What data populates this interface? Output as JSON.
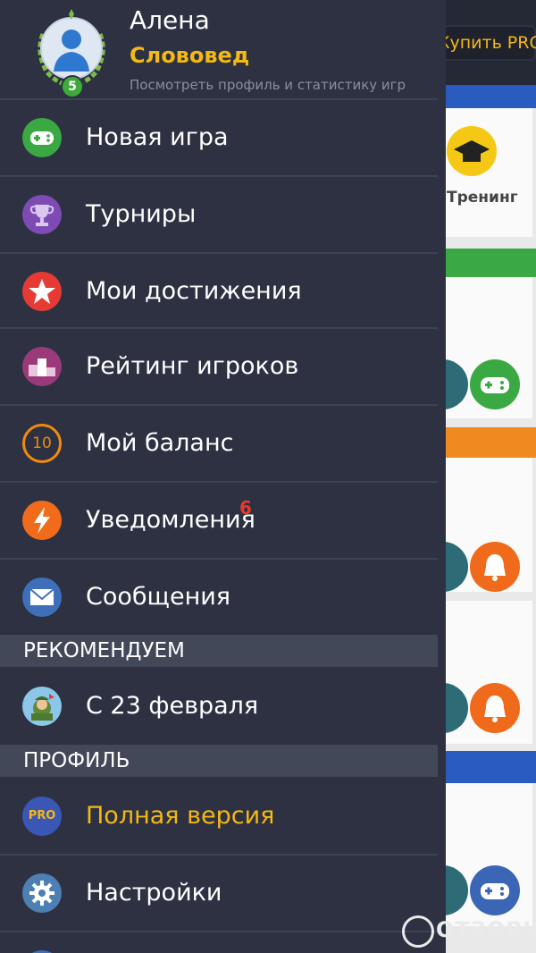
{
  "background": {
    "buy_pro_label": "Купить PRO",
    "training_label": "Тренинг"
  },
  "profile": {
    "name": "Алена",
    "rank": "Слововед",
    "subtitle": "Посмотреть профиль и статистику игр",
    "level": "5"
  },
  "menu": [
    {
      "label": "Новая игра",
      "icon": "gamepad-icon",
      "color": "#3aa843"
    },
    {
      "label": "Турниры",
      "icon": "trophy-icon",
      "color": "#7e4bb5"
    },
    {
      "label": "Мои достижения",
      "icon": "star-icon",
      "color": "#e63b35"
    },
    {
      "label": "Рейтинг игроков",
      "icon": "podium-icon",
      "color": "#9a3a7a"
    },
    {
      "label": "Мой баланс",
      "icon": "coin-icon",
      "color": "#f08a10",
      "coin_value": "10"
    },
    {
      "label": "Уведомления",
      "icon": "lightning-icon",
      "color": "#f26b1b",
      "badge": "6"
    },
    {
      "label": "Сообщения",
      "icon": "envelope-icon",
      "color": "#3f6fb8"
    }
  ],
  "recommend": {
    "header": "РЕКОМЕНДУЕМ",
    "item": {
      "label": "С 23 февраля",
      "icon": "soldier-icon"
    }
  },
  "profile_section": {
    "header": "ПРОФИЛЬ",
    "items": [
      {
        "label": "Полная версия",
        "icon": "pro-icon",
        "icon_text": "PRO",
        "color": "#f4b914"
      },
      {
        "label": "Настройки",
        "icon": "gear-icon",
        "color": "#ffffff"
      }
    ]
  },
  "watermark": "ОТЗОВИК"
}
